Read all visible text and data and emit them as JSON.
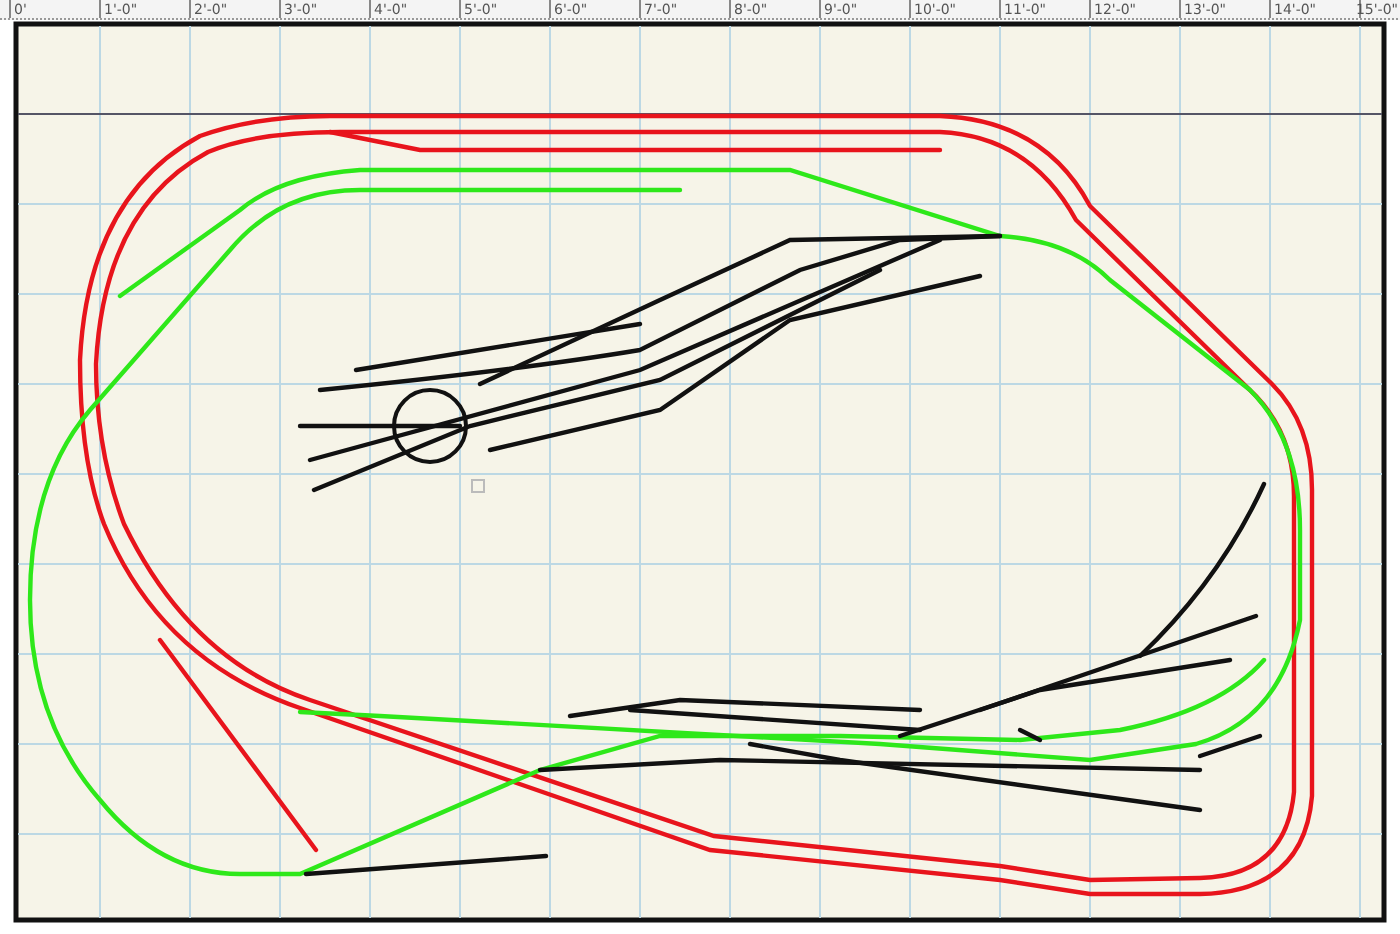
{
  "ruler": {
    "labels": [
      "0'",
      "1'-0\"",
      "2'-0\"",
      "3'-0\"",
      "4'-0\"",
      "5'-0\"",
      "6'-0\"",
      "7'-0\"",
      "8'-0\"",
      "9'-0\"",
      "10'-0\"",
      "11'-0\"",
      "12'-0\"",
      "13'-0\"",
      "14'-0\"",
      "15'-0\""
    ]
  },
  "track_plan": {
    "tracks": [
      {
        "kind": "outer",
        "color": "#e8141c"
      },
      {
        "kind": "inner",
        "color": "#2ee81a"
      },
      {
        "kind": "yard",
        "color": "#111111"
      }
    ]
  }
}
